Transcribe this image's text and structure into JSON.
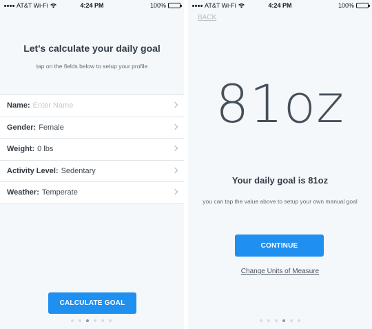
{
  "status_bar": {
    "carrier": "AT&T Wi-Fi",
    "time": "4:24 PM",
    "battery": "100%"
  },
  "left_screen": {
    "title": "Let's calculate your daily goal",
    "subtitle": "tap on the fields below to setup your profile",
    "fields": [
      {
        "label": "Name:",
        "value": "Enter Name",
        "is_placeholder": true
      },
      {
        "label": "Gender:",
        "value": "Female",
        "is_placeholder": false
      },
      {
        "label": "Weight:",
        "value": "0 lbs",
        "is_placeholder": false
      },
      {
        "label": "Activity Level:",
        "value": "Sedentary",
        "is_placeholder": false
      },
      {
        "label": "Weather:",
        "value": "Temperate",
        "is_placeholder": false
      }
    ],
    "button_label": "CALCULATE GOAL",
    "page_indicator": {
      "count": 6,
      "active_index": 2
    }
  },
  "right_screen": {
    "back_label": "BACK",
    "goal_value": "81oz",
    "goal_heading": "Your daily goal is 81oz",
    "goal_description": "you can tap the value above to setup your own manual goal",
    "button_label": "CONTINUE",
    "units_link": "Change Units of Measure",
    "page_indicator": {
      "count": 6,
      "active_index": 3
    }
  },
  "colors": {
    "accent": "#1f8ff0",
    "background": "#f4f8fb",
    "text_dark": "#333c47"
  }
}
